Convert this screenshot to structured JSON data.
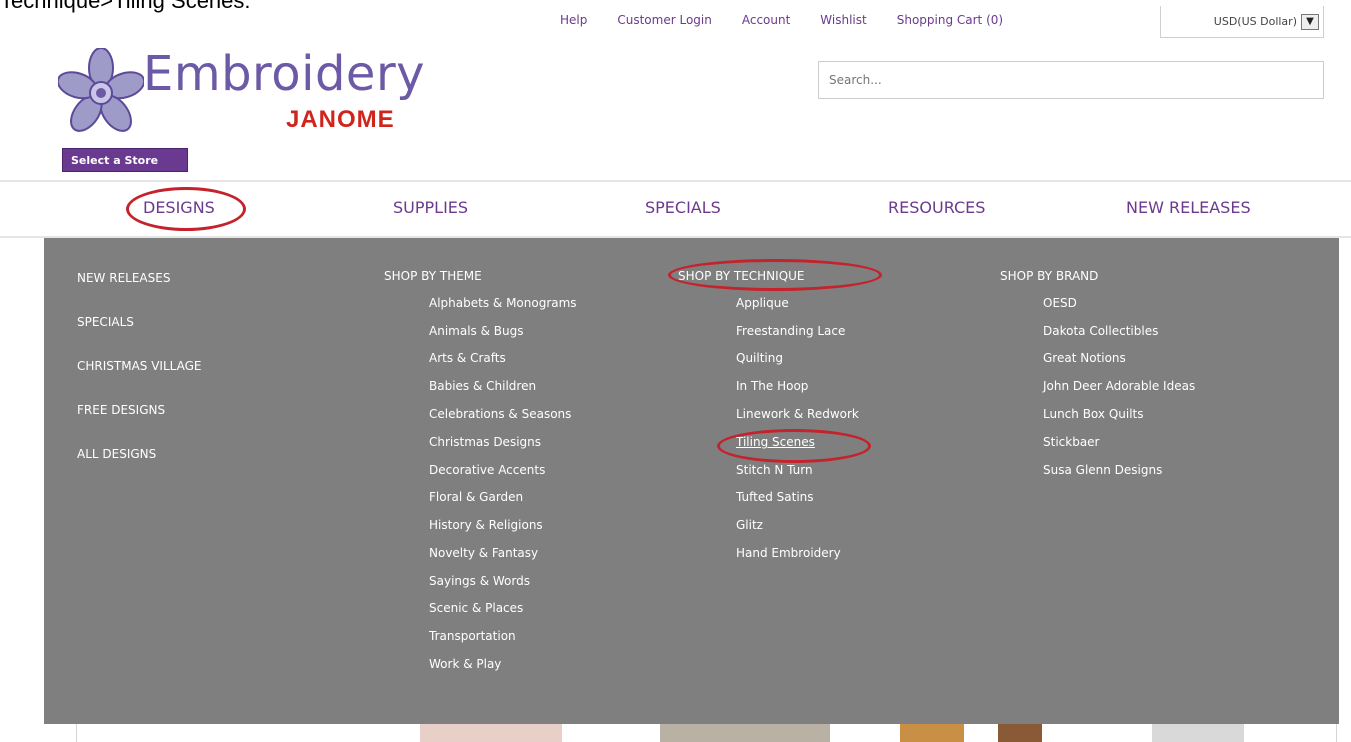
{
  "caption": "Technique>Tiling Scenes:",
  "top_links": [
    "Help",
    "Customer Login",
    "Account",
    "Wishlist",
    "Shopping Cart (0)"
  ],
  "currency": "USD(US Dollar)",
  "logo": {
    "word": "Embroidery",
    "brand": "JANOME"
  },
  "select_store": "Select a Store",
  "search": {
    "placeholder": "Search..."
  },
  "nav": [
    "DESIGNS",
    "SUPPLIES",
    "SPECIALS",
    "RESOURCES",
    "NEW RELEASES"
  ],
  "menu": {
    "left": [
      "NEW RELEASES",
      "SPECIALS",
      "CHRISTMAS VILLAGE",
      "FREE DESIGNS",
      "ALL DESIGNS"
    ],
    "theme": {
      "heading": "SHOP BY THEME",
      "items": [
        "Alphabets & Monograms",
        "Animals & Bugs",
        "Arts & Crafts",
        "Babies & Children",
        "Celebrations & Seasons",
        "Christmas Designs",
        "Decorative Accents",
        "Floral & Garden",
        "History & Religions",
        "Novelty & Fantasy",
        "Sayings & Words",
        "Scenic & Places",
        "Transportation",
        "Work & Play"
      ]
    },
    "technique": {
      "heading": "SHOP BY TECHNIQUE",
      "items": [
        "Applique",
        "Freestanding Lace",
        "Quilting",
        "In The Hoop",
        "Linework & Redwork",
        "Tiling Scenes",
        "Stitch N Turn",
        "Tufted Satins",
        "Glitz",
        "Hand Embroidery"
      ]
    },
    "brand": {
      "heading": "SHOP BY BRAND",
      "items": [
        "OESD",
        "Dakota Collectibles",
        "Great Notions",
        "John Deer Adorable Ideas",
        "Lunch Box Quilts",
        "Stickbaer",
        "Susa Glenn Designs"
      ]
    }
  },
  "colors": {
    "accent": "#6b3a8e",
    "highlight_ring": "#c4232b",
    "menu_bg": "#7f7f7f",
    "brand_red": "#d0251d"
  }
}
